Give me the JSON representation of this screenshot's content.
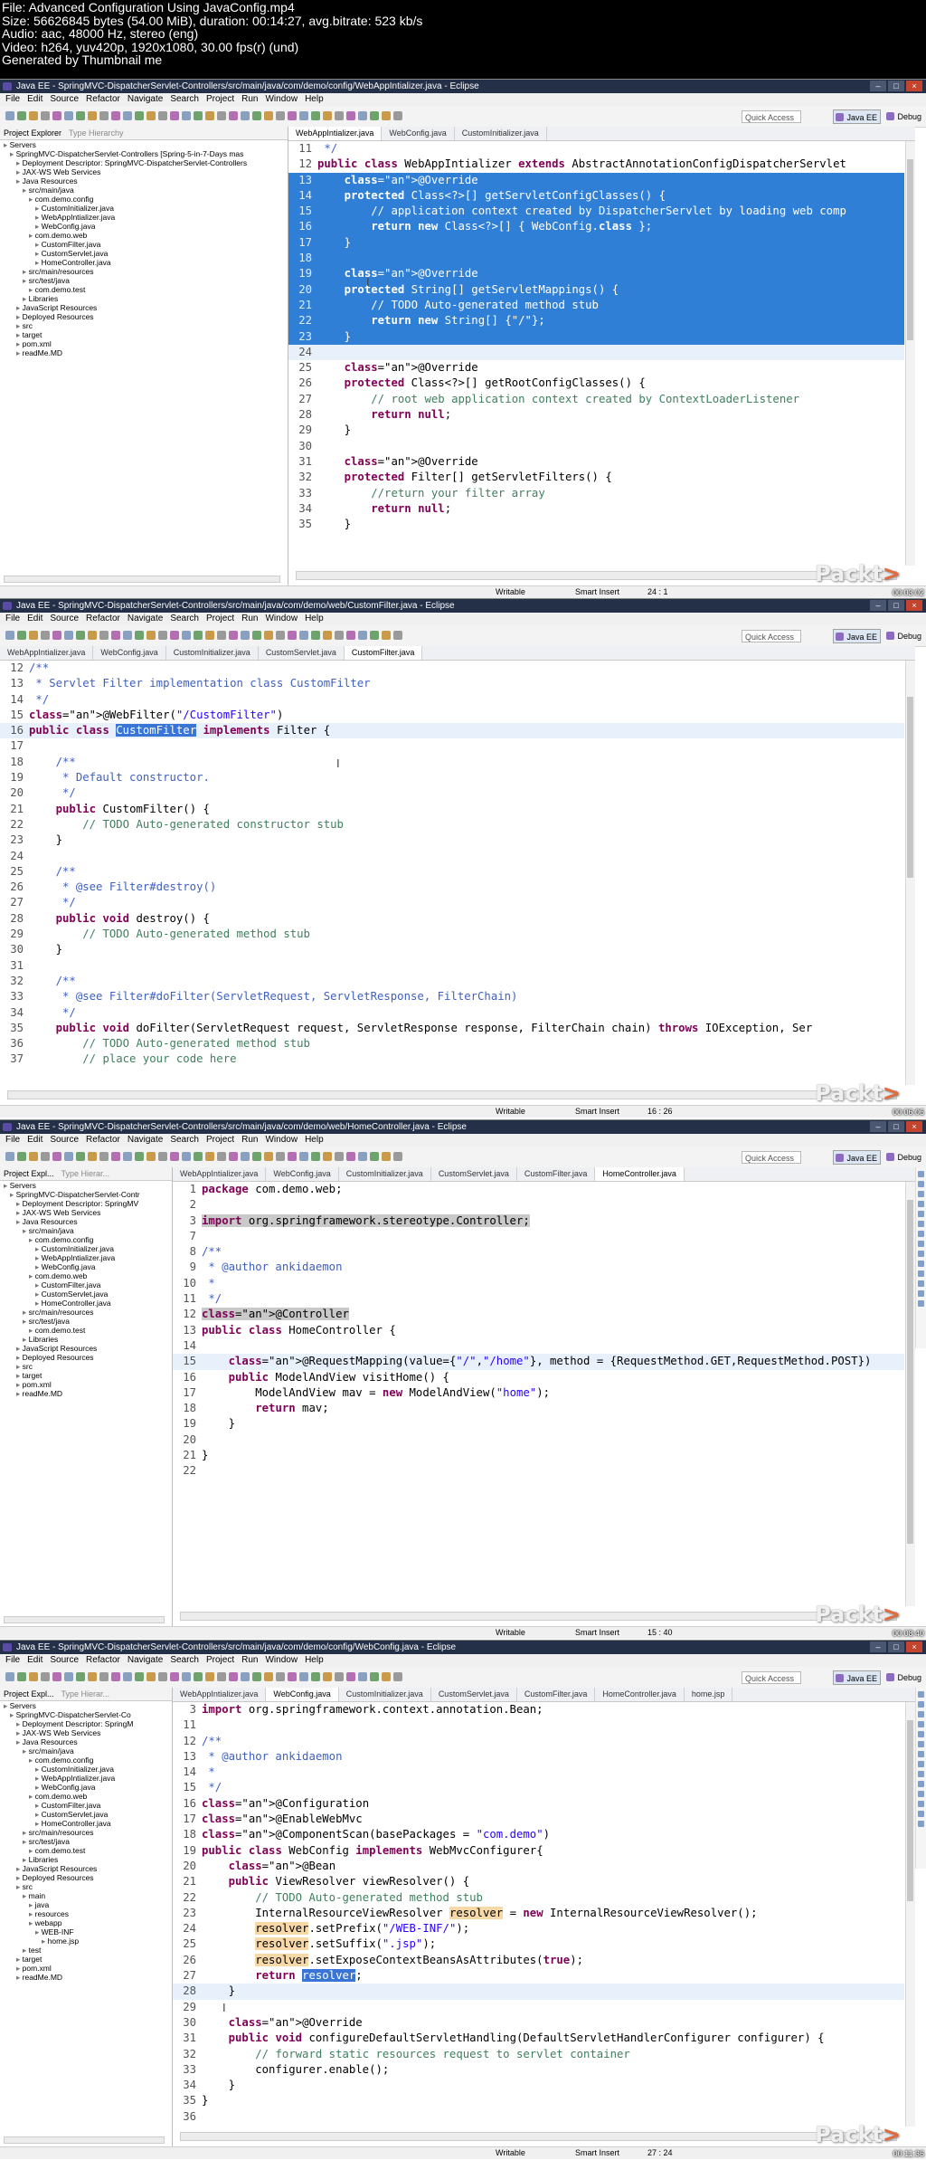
{
  "header": {
    "file": "File: Advanced Configuration Using JavaConfig.mp4",
    "size": "Size: 56626845 bytes (54.00 MiB), duration: 00:14:27, avg.bitrate: 523 kb/s",
    "audio": "Audio: aac, 48000 Hz, stereo (eng)",
    "video": "Video: h264, yuv420p, 1920x1080, 30.00 fps(r) (und)",
    "generated": "Generated by Thumbnail me"
  },
  "common": {
    "menu": [
      "File",
      "Edit",
      "Source",
      "Refactor",
      "Navigate",
      "Search",
      "Project",
      "Run",
      "Window",
      "Help"
    ],
    "quick_access": "Quick Access",
    "perspective_java": "Java EE",
    "perspective_debug": "Debug",
    "status_writable": "Writable",
    "status_insert": "Smart Insert",
    "logo": "Packt",
    "logo_mark": ">"
  },
  "frames": [
    {
      "title": "Java EE - SpringMVC-DispatcherServlet-Controllers/src/main/java/com/demo/config/WebAppIntializer.java - Eclipse",
      "tabs": [
        "WebAppIntializer.java",
        "WebConfig.java",
        "CustomInitializer.java"
      ],
      "explorer_title": "Project Explorer",
      "explorer_title2": "Type Hierarchy",
      "tree": [
        "Servers",
        "SpringMVC-DispatcherServlet-Controllers [Spring-5-in-7-Days mas",
        "Deployment Descriptor: SpringMVC-DispatcherServlet-Controllers",
        "JAX-WS Web Services",
        "Java Resources",
        "src/main/java",
        "com.demo.config",
        "CustomInitializer.java",
        "WebAppIntializer.java",
        "WebConfig.java",
        "com.demo.web",
        "CustomFilter.java",
        "CustomServlet.java",
        "HomeController.java",
        "src/main/resources",
        "src/test/java",
        "com.demo.test",
        "Libraries",
        "JavaScript Resources",
        "Deployed Resources",
        "src",
        "target",
        "pom.xml",
        "readMe.MD"
      ],
      "cursor": "24 : 1",
      "timestamp": "00:03:02",
      "lines": [
        {
          "n": "11",
          "t": " */"
        },
        {
          "n": "12",
          "t": "public class WebAppIntializer extends AbstractAnnotationConfigDispatcherServlet"
        },
        {
          "n": "13",
          "t": "    @Override"
        },
        {
          "n": "14",
          "t": "    protected Class<?>[] getServletConfigClasses() {"
        },
        {
          "n": "15",
          "t": "        // application context created by DispatcherServlet by loading web comp"
        },
        {
          "n": "16",
          "t": "        return new Class<?>[] { WebConfig.class };"
        },
        {
          "n": "17",
          "t": "    }"
        },
        {
          "n": "18",
          "t": ""
        },
        {
          "n": "19",
          "t": "    @Override"
        },
        {
          "n": "20",
          "t": "    protected String[] getServletMappings() {"
        },
        {
          "n": "21",
          "t": "        // TODO Auto-generated method stub"
        },
        {
          "n": "22",
          "t": "        return new String[] {\"/\"};"
        },
        {
          "n": "23",
          "t": "    }"
        },
        {
          "n": "24",
          "t": ""
        },
        {
          "n": "25",
          "t": "    @Override"
        },
        {
          "n": "26",
          "t": "    protected Class<?>[] getRootConfigClasses() {"
        },
        {
          "n": "27",
          "t": "        // root web application context created by ContextLoaderListener"
        },
        {
          "n": "28",
          "t": "        return null;"
        },
        {
          "n": "29",
          "t": "    }"
        },
        {
          "n": "30",
          "t": ""
        },
        {
          "n": "31",
          "t": "    @Override"
        },
        {
          "n": "32",
          "t": "    protected Filter[] getServletFilters() {"
        },
        {
          "n": "33",
          "t": "        //return your filter array"
        },
        {
          "n": "34",
          "t": "        return null;"
        },
        {
          "n": "35",
          "t": "    }"
        }
      ]
    },
    {
      "title": "Java EE - SpringMVC-DispatcherServlet-Controllers/src/main/java/com/demo/web/CustomFilter.java - Eclipse",
      "tabs": [
        "WebAppIntializer.java",
        "WebConfig.java",
        "CustomInitializer.java",
        "CustomServlet.java",
        "CustomFilter.java"
      ],
      "cursor": "16 : 26",
      "timestamp": "00:06:06",
      "lines": [
        {
          "n": "12",
          "t": "/**"
        },
        {
          "n": "13",
          "t": " * Servlet Filter implementation class CustomFilter"
        },
        {
          "n": "14",
          "t": " */"
        },
        {
          "n": "15",
          "t": "@WebFilter(\"/CustomFilter\")"
        },
        {
          "n": "16",
          "t": "public class CustomFilter implements Filter {"
        },
        {
          "n": "17",
          "t": ""
        },
        {
          "n": "18",
          "t": "    /**"
        },
        {
          "n": "19",
          "t": "     * Default constructor."
        },
        {
          "n": "20",
          "t": "     */"
        },
        {
          "n": "21",
          "t": "    public CustomFilter() {"
        },
        {
          "n": "22",
          "t": "        // TODO Auto-generated constructor stub"
        },
        {
          "n": "23",
          "t": "    }"
        },
        {
          "n": "24",
          "t": ""
        },
        {
          "n": "25",
          "t": "    /**"
        },
        {
          "n": "26",
          "t": "     * @see Filter#destroy()"
        },
        {
          "n": "27",
          "t": "     */"
        },
        {
          "n": "28",
          "t": "    public void destroy() {"
        },
        {
          "n": "29",
          "t": "        // TODO Auto-generated method stub"
        },
        {
          "n": "30",
          "t": "    }"
        },
        {
          "n": "31",
          "t": ""
        },
        {
          "n": "32",
          "t": "    /**"
        },
        {
          "n": "33",
          "t": "     * @see Filter#doFilter(ServletRequest, ServletResponse, FilterChain)"
        },
        {
          "n": "34",
          "t": "     */"
        },
        {
          "n": "35",
          "t": "    public void doFilter(ServletRequest request, ServletResponse response, FilterChain chain) throws IOException, Ser"
        },
        {
          "n": "36",
          "t": "        // TODO Auto-generated method stub"
        },
        {
          "n": "37",
          "t": "        // place your code here"
        }
      ]
    },
    {
      "title": "Java EE - SpringMVC-DispatcherServlet-Controllers/src/main/java/com/demo/web/HomeController.java - Eclipse",
      "tabs": [
        "WebAppIntializer.java",
        "WebConfig.java",
        "CustomInitializer.java",
        "CustomServlet.java",
        "CustomFilter.java",
        "HomeController.java"
      ],
      "explorer_title": "Project Expl...",
      "explorer_title2": "Type Hierar...",
      "tree": [
        "Servers",
        "SpringMVC-DispatcherServlet-Contr",
        "Deployment Descriptor: SpringMV",
        "JAX-WS Web Services",
        "Java Resources",
        "src/main/java",
        "com.demo.config",
        "CustomInitializer.java",
        "WebAppIntializer.java",
        "WebConfig.java",
        "com.demo.web",
        "CustomFilter.java",
        "CustomServlet.java",
        "HomeController.java",
        "src/main/resources",
        "src/test/java",
        "com.demo.test",
        "Libraries",
        "JavaScript Resources",
        "Deployed Resources",
        "src",
        "target",
        "pom.xml",
        "readMe.MD"
      ],
      "cursor": "15 : 40",
      "timestamp": "00:08:40",
      "lines": [
        {
          "n": "1",
          "t": "package com.demo.web;"
        },
        {
          "n": "2",
          "t": ""
        },
        {
          "n": "3",
          "t": "import org.springframework.stereotype.Controller;"
        },
        {
          "n": "7",
          "t": ""
        },
        {
          "n": "8",
          "t": "/**"
        },
        {
          "n": "9",
          "t": " * @author ankidaemon"
        },
        {
          "n": "10",
          "t": " *"
        },
        {
          "n": "11",
          "t": " */"
        },
        {
          "n": "12",
          "t": "@Controller"
        },
        {
          "n": "13",
          "t": "public class HomeController {"
        },
        {
          "n": "14",
          "t": ""
        },
        {
          "n": "15",
          "t": "    @RequestMapping(value={\"/\",\"/home\"}, method = {RequestMethod.GET,RequestMethod.POST})"
        },
        {
          "n": "16",
          "t": "    public ModelAndView visitHome() {"
        },
        {
          "n": "17",
          "t": "        ModelAndView mav = new ModelAndView(\"home\");"
        },
        {
          "n": "18",
          "t": "        return mav;"
        },
        {
          "n": "19",
          "t": "    }"
        },
        {
          "n": "20",
          "t": ""
        },
        {
          "n": "21",
          "t": "}"
        },
        {
          "n": "22",
          "t": ""
        }
      ]
    },
    {
      "title": "Java EE - SpringMVC-DispatcherServlet-Controllers/src/main/java/com/demo/config/WebConfig.java - Eclipse",
      "tabs": [
        "WebAppIntializer.java",
        "WebConfig.java",
        "CustomInitializer.java",
        "CustomServlet.java",
        "CustomFilter.java",
        "HomeController.java",
        "home.jsp"
      ],
      "explorer_title": "Project Expl...",
      "explorer_title2": "Type Hierar...",
      "tree": [
        "Servers",
        "SpringMVC-DispatcherServlet-Co",
        "Deployment Descriptor: SpringM",
        "JAX-WS Web Services",
        "Java Resources",
        "src/main/java",
        "com.demo.config",
        "CustomInitializer.java",
        "WebAppIntializer.java",
        "WebConfig.java",
        "com.demo.web",
        "CustomFilter.java",
        "CustomServlet.java",
        "HomeController.java",
        "src/main/resources",
        "src/test/java",
        "com.demo.test",
        "Libraries",
        "JavaScript Resources",
        "Deployed Resources",
        "src",
        "main",
        "java",
        "resources",
        "webapp",
        "WEB-INF",
        "home.jsp",
        "test",
        "target",
        "pom.xml",
        "readMe.MD"
      ],
      "cursor": "27 : 24",
      "timestamp": "00:11:36",
      "lines": [
        {
          "n": "3",
          "t": "import org.springframework.context.annotation.Bean;"
        },
        {
          "n": "11",
          "t": ""
        },
        {
          "n": "12",
          "t": "/**"
        },
        {
          "n": "13",
          "t": " * @author ankidaemon"
        },
        {
          "n": "14",
          "t": " *"
        },
        {
          "n": "15",
          "t": " */"
        },
        {
          "n": "16",
          "t": "@Configuration"
        },
        {
          "n": "17",
          "t": "@EnableWebMvc"
        },
        {
          "n": "18",
          "t": "@ComponentScan(basePackages = \"com.demo\")"
        },
        {
          "n": "19",
          "t": "public class WebConfig implements WebMvcConfigurer{"
        },
        {
          "n": "20",
          "t": "    @Bean"
        },
        {
          "n": "21",
          "t": "    public ViewResolver viewResolver() {"
        },
        {
          "n": "22",
          "t": "        // TODO Auto-generated method stub"
        },
        {
          "n": "23",
          "t": "        InternalResourceViewResolver resolver = new InternalResourceViewResolver();"
        },
        {
          "n": "24",
          "t": "        resolver.setPrefix(\"/WEB-INF/\");"
        },
        {
          "n": "25",
          "t": "        resolver.setSuffix(\".jsp\");"
        },
        {
          "n": "26",
          "t": "        resolver.setExposeContextBeansAsAttributes(true);"
        },
        {
          "n": "27",
          "t": "        return resolver;"
        },
        {
          "n": "28",
          "t": "    }"
        },
        {
          "n": "29",
          "t": ""
        },
        {
          "n": "30",
          "t": "    @Override"
        },
        {
          "n": "31",
          "t": "    public void configureDefaultServletHandling(DefaultServletHandlerConfigurer configurer) {"
        },
        {
          "n": "32",
          "t": "        // forward static resources request to servlet container"
        },
        {
          "n": "33",
          "t": "        configurer.enable();"
        },
        {
          "n": "34",
          "t": "    }"
        },
        {
          "n": "35",
          "t": "}"
        },
        {
          "n": "36",
          "t": ""
        }
      ]
    }
  ]
}
